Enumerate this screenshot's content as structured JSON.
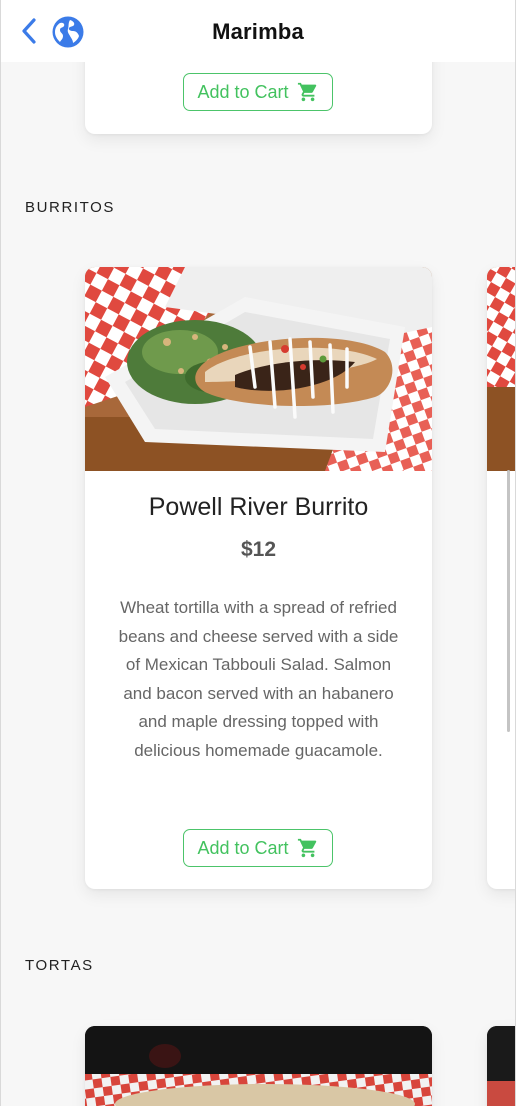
{
  "header": {
    "title": "Marimba",
    "back_icon": "chevron-left-icon",
    "globe_icon": "globe-icon",
    "accent_color": "#3b82f6"
  },
  "previous_item": {
    "cart_label": "Add to Cart",
    "cart_icon": "shopping-cart-icon"
  },
  "sections": {
    "burritos": {
      "heading": "BURRITOS",
      "item": {
        "name": "Powell River Burrito",
        "price": "$12",
        "description": "Wheat tortilla with a spread of refried beans and cheese served with a side of Mexican Tabbouli Salad. Salmon and bacon served with an habanero and maple dressing topped with delicious homemade guacamole.",
        "cart_label": "Add to Cart",
        "cart_icon": "shopping-cart-icon"
      }
    },
    "tortas": {
      "heading": "TORTAS"
    }
  },
  "colors": {
    "cart_green": "#43c25f",
    "background": "#f7f7f7"
  }
}
